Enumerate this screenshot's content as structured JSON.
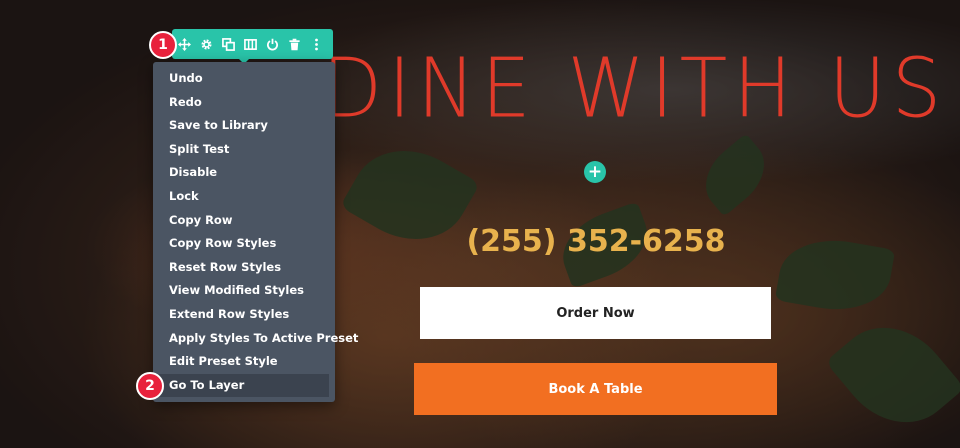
{
  "hero": {
    "title": "DINE WITH US",
    "phone": "(255) 352-6258",
    "order_button": "Order Now",
    "book_button": "Book A Table",
    "add_icon": "+"
  },
  "toolbar": {
    "icons": [
      "move-icon",
      "gear-icon",
      "duplicate-icon",
      "columns-icon",
      "power-icon",
      "trash-icon",
      "more-vertical-icon"
    ]
  },
  "badges": {
    "one": "1",
    "two": "2"
  },
  "menu": {
    "items": [
      "Undo",
      "Redo",
      "Save to Library",
      "Split Test",
      "Disable",
      "Lock",
      "Copy Row",
      "Copy Row Styles",
      "Reset Row Styles",
      "View Modified Styles",
      "Extend Row Styles",
      "Apply Styles To Active Preset",
      "Edit Preset Style",
      "Go To Layer"
    ],
    "active_item": "Go To Layer"
  },
  "colors": {
    "accent": "#29c4a9",
    "title": "#e03a2a",
    "phone": "#e8b24d",
    "book_button": "#f26f21",
    "badge": "#e8213c",
    "menu_bg": "#4b5563"
  }
}
